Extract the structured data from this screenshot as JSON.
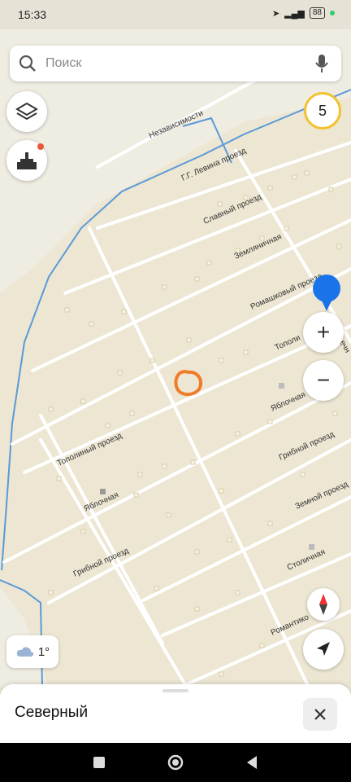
{
  "status": {
    "time": "15:33",
    "battery": "88"
  },
  "search": {
    "placeholder": "Поиск"
  },
  "map": {
    "cluster_count": "5",
    "streets": {
      "nezavisimosti": "Независимости",
      "levina": "Г.Г. Левина проезд",
      "slavny": "Славный проезд",
      "zemlyanichnaya": "Земляничная",
      "romashkovy": "Ромашковый проезд",
      "topolny_right": "Тополи",
      "yablochnaya_right": "Яблочная",
      "topolny_left": "Тополиный проезд",
      "gribnoy_right": "Грибной проезд",
      "yablochnaya_left": "Яблочная",
      "zemnoy": "Земной проезд",
      "gribnoy_left": "Грибной проезд",
      "stolichnaya": "Столичная",
      "romantiko": "Романтико",
      "vertical_right": "ечн"
    }
  },
  "zoom": {
    "in": "+",
    "out": "−"
  },
  "weather": {
    "temp": "1°"
  },
  "sheet": {
    "title": "Северный"
  },
  "colors": {
    "route_marker": "#f07c2a",
    "pin": "#1a73e8",
    "water": "#4a90d9",
    "cluster_ring": "#f2c230"
  }
}
